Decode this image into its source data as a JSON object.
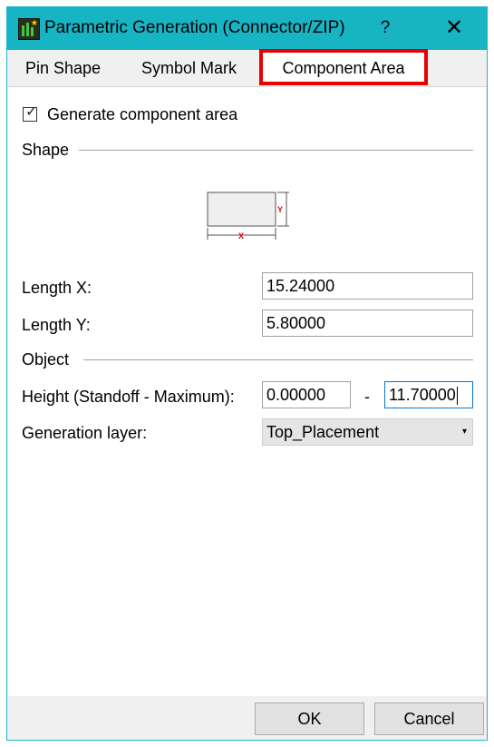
{
  "window": {
    "title": "Parametric Generation (Connector/ZIP)",
    "help_label": "?",
    "close_label": "✕"
  },
  "tabs": [
    {
      "label": "Pin Shape",
      "active": false
    },
    {
      "label": "Symbol Mark",
      "active": false
    },
    {
      "label": "Component Area",
      "active": true
    }
  ],
  "content": {
    "generate_checkbox": {
      "label": "Generate component area",
      "checked": true
    },
    "shape_section": "Shape",
    "diagram": {
      "x_label": "X",
      "y_label": "Y"
    },
    "length_x": {
      "label": "Length X:",
      "value": "15.24000"
    },
    "length_y": {
      "label": "Length Y:",
      "value": "5.80000"
    },
    "object_section": "Object",
    "height": {
      "label": "Height (Standoff - Maximum):",
      "standoff": "0.00000",
      "separator": "-",
      "maximum": "11.70000"
    },
    "layer": {
      "label": "Generation layer:",
      "value": "Top_Placement"
    }
  },
  "buttons": {
    "ok": "OK",
    "cancel": "Cancel"
  },
  "colors": {
    "titlebar": "#17b4c4",
    "highlight": "#e60000",
    "focus": "#0078d7"
  }
}
